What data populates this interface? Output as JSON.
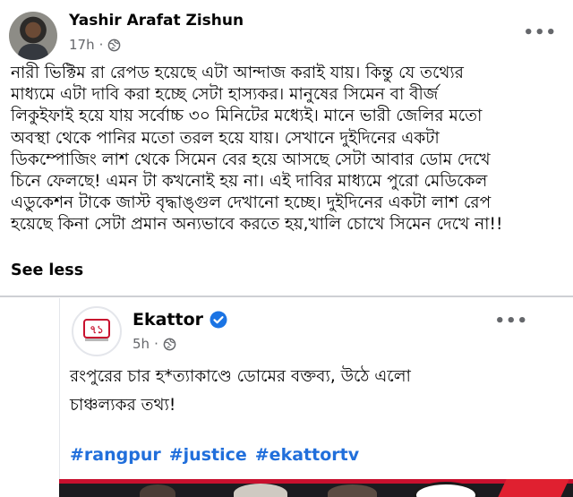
{
  "post": {
    "author": "Yashir Arafat Zishun",
    "time": "17h",
    "more_icon": "ellipsis-icon",
    "privacy_icon": "globe-icon",
    "text_lines": [
      "নারী ভিক্টিম রা রেপড হয়েছে এটা আন্দাজ করাই যায়। কিন্তু যে তথ্যের",
      "মাধ্যমে এটা দাবি করা হচ্ছে সেটা হাস্যকর। মানুষের সিমেন বা বীর্জ",
      "লিকুইফাই হয়ে যায় সর্বোচ্চ ৩০ মিনিটের মধ্যেই। মানে ভারী জেলির মতো",
      "অবস্থা থেকে পানির মতো তরল হয়ে যায়। সেখানে দুইদিনের একটা",
      "ডিকম্পোজিং লাশ থেকে সিমেন বের হয়ে আসছে সেটা আবার ডোম দেখে",
      "চিনে ফেলছে! এমন টা কখনোই হয় না। এই দাবির মাধ্যমে পুরো মেডিকেল",
      "এডুকেশন টাকে জাস্ট বৃদ্ধাঙ্গুল দেখানো হচ্ছে। দুইদিনের একটা লাশ রেপ",
      "হয়েছে কিনা সেটা প্রমান অন্যভাবে করতে হয়,খালি চোখে সিমেন দেখে না!!"
    ],
    "see_less": "See less"
  },
  "shared": {
    "page_name": "Ekattor",
    "time": "5h",
    "text_lines": [
      "রংপুরের চার হ*ত্যাকাণ্ডে ডোমের বক্তব্য, উঠে এলো",
      "চাঞ্চল্যকর তথ্য!"
    ],
    "hashtags": [
      "#rangpur",
      "#justice",
      "#ekattortv"
    ]
  },
  "colors": {
    "hashtag": "#216fdb",
    "verified": "#1b74e4",
    "meta": "#65676b"
  }
}
